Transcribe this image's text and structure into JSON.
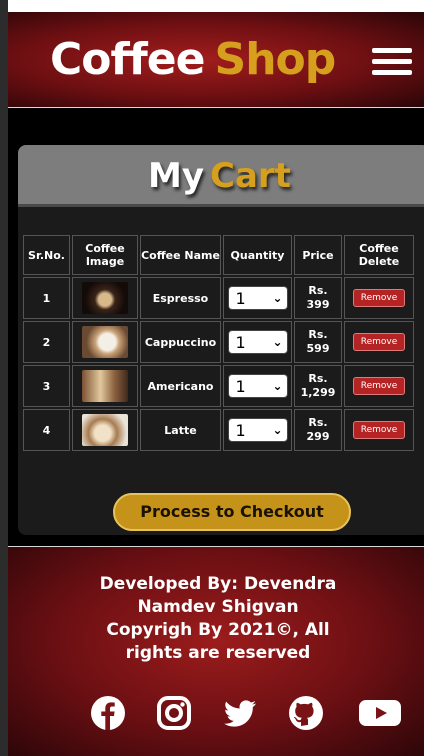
{
  "header": {
    "brand_word1": "Coffee",
    "brand_word2": "Shop",
    "menu_icon": "hamburger-menu-icon"
  },
  "cart": {
    "title_word1": "My",
    "title_word2": "Cart",
    "columns": [
      "Sr.No.",
      "Coffee Image",
      "Coffee Name",
      "Quantity",
      "Price",
      "Coffee Delete"
    ],
    "items": [
      {
        "sr": "1",
        "name": "Espresso",
        "qty": "1",
        "price_label": "Rs.",
        "price_value": "399",
        "remove": "Remove"
      },
      {
        "sr": "2",
        "name": "Cappuccino",
        "qty": "1",
        "price_label": "Rs.",
        "price_value": "599",
        "remove": "Remove"
      },
      {
        "sr": "3",
        "name": "Americano",
        "qty": "1",
        "price_label": "Rs.",
        "price_value": "1,299",
        "remove": "Remove"
      },
      {
        "sr": "4",
        "name": "Latte",
        "qty": "1",
        "price_label": "Rs.",
        "price_value": "299",
        "remove": "Remove"
      }
    ],
    "checkout_label": "Process to Checkout"
  },
  "footer": {
    "line1": "Developed By: Devendra",
    "line2": "Namdev Shigvan",
    "line3": "Copyrigh By 2021©, All",
    "line4": "rights are reserved",
    "social_icons": [
      "facebook-icon",
      "instagram-icon",
      "twitter-icon",
      "github-icon",
      "youtube-icon"
    ]
  },
  "colors": {
    "accent_gold": "#d6a01e",
    "header_red": "#a31d1d",
    "remove_red": "#b52424",
    "checkout_gold": "#c5921a"
  }
}
